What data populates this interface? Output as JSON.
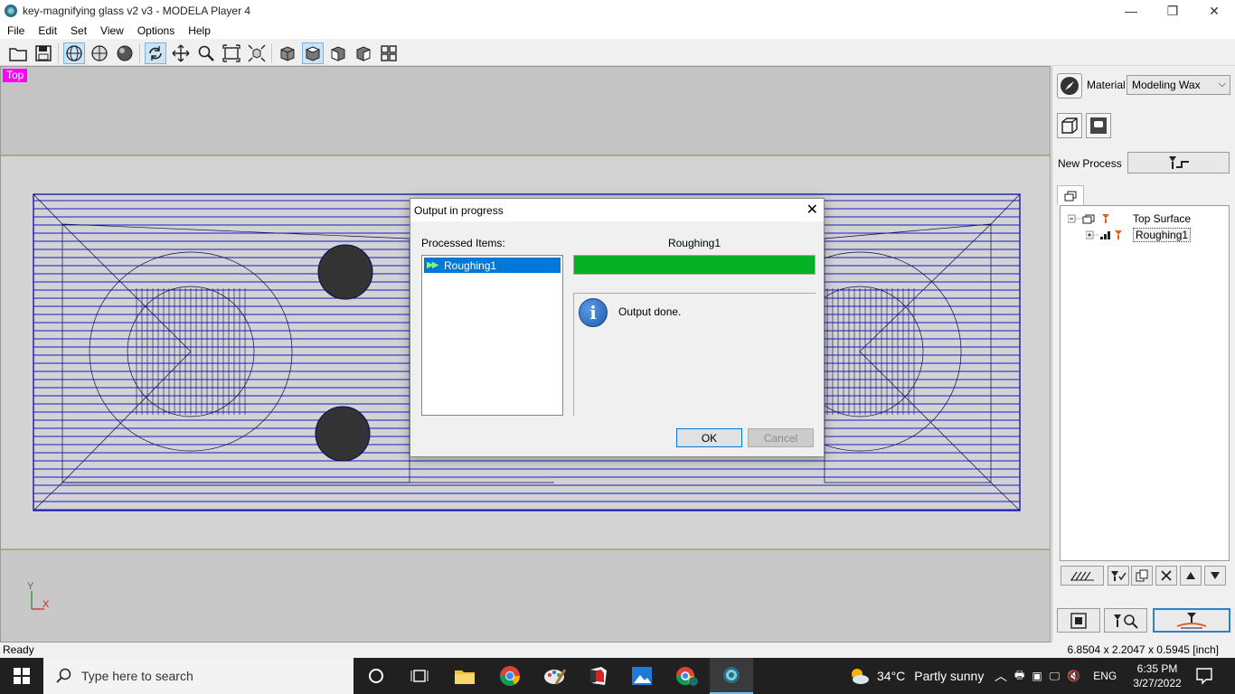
{
  "window": {
    "title": "key-magnifying glass v2 v3 - MODELA Player 4",
    "minimize_glyph": "—",
    "maximize_glyph": "❐",
    "close_glyph": "✕"
  },
  "menu": [
    "File",
    "Edit",
    "Set",
    "View",
    "Options",
    "Help"
  ],
  "viewport": {
    "view_label": "Top",
    "axis_y": "Y",
    "axis_x": "X"
  },
  "right_panel": {
    "material_label": "Material",
    "material_value": "Modeling Wax",
    "new_process_label": "New Process",
    "tree": {
      "root": "Top Surface",
      "child": "Roughing1"
    }
  },
  "status": {
    "left": "Ready",
    "right": "6.8504 x 2.2047 x 0.5945 [inch]"
  },
  "dialog": {
    "title": "Output in progress",
    "processed_label": "Processed Items:",
    "processed_items": [
      "Roughing1"
    ],
    "current_name": "Roughing1",
    "progress": 1.0,
    "message": "Output done.",
    "ok_label": "OK",
    "cancel_label": "Cancel"
  },
  "taskbar": {
    "search_placeholder": "Type here to search",
    "weather_temp": "34°C",
    "weather_desc": "Partly sunny",
    "lang": "ENG",
    "time": "6:35 PM",
    "date": "3/27/2022"
  }
}
